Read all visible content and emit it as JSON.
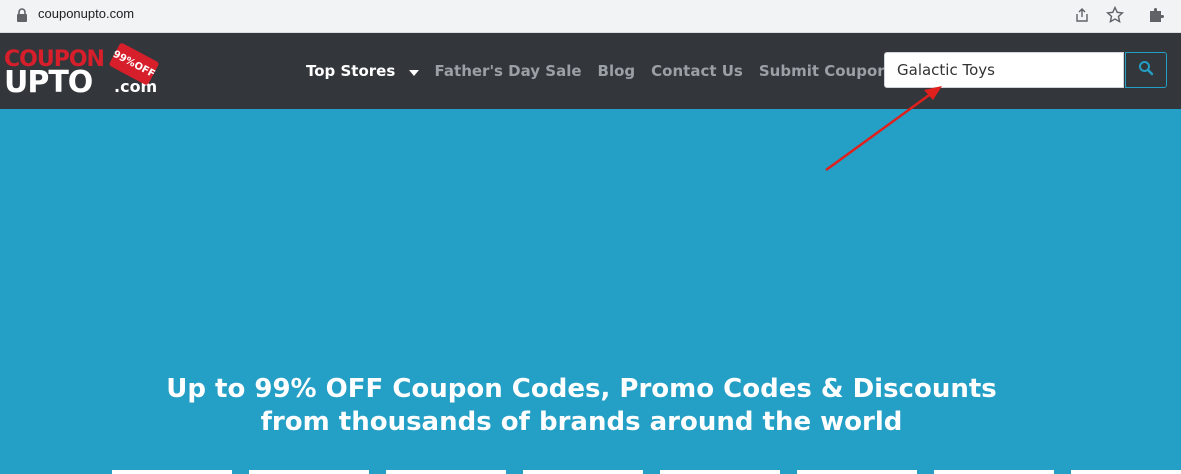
{
  "browser": {
    "url": "couponupto.com",
    "icons": [
      "lock-icon",
      "share-icon",
      "star-icon",
      "puzzle-icon"
    ]
  },
  "logo": {
    "line1": "COUPON",
    "line2": "UPTO",
    "suffix": ".com",
    "tag": "99%OFF"
  },
  "nav": {
    "items": [
      {
        "label": "Top Stores",
        "active": true,
        "has_dropdown": true
      },
      {
        "label": "Father's Day Sale",
        "active": false
      },
      {
        "label": "Blog",
        "active": false
      },
      {
        "label": "Contact Us",
        "active": false
      },
      {
        "label": "Submit Coupon",
        "active": false
      }
    ]
  },
  "search": {
    "value": "Galactic Toys",
    "button_icon": "search-icon"
  },
  "hero": {
    "line1": "Up to 99% OFF Coupon Codes, Promo Codes & Discounts",
    "line2": "from thousands of brands around the world"
  },
  "colors": {
    "header_bg": "#33363b",
    "hero_bg": "#249fc6",
    "brand_red": "#d61f2b",
    "annotation_arrow": "#e0201c"
  }
}
